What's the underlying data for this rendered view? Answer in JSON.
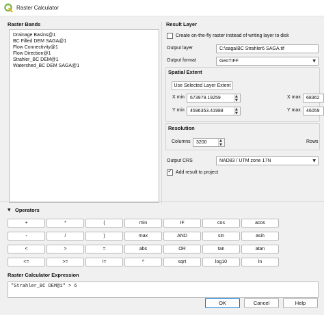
{
  "window": {
    "title": "Raster Calculator"
  },
  "raster_bands": {
    "heading": "Raster Bands",
    "items": [
      "Drainage Basins@1",
      "BC Filled DEM SAGA@1",
      "Flow Connectivity@1",
      "Flow Direction@1",
      "Strahler_BC DEM@1",
      "Watershed_BC DEM SAGA@1"
    ]
  },
  "result_layer": {
    "heading": "Result Layer",
    "create_on_the_fly_label": "Create on-the-fly raster instead of writing layer to disk",
    "create_on_the_fly_checked": false,
    "output_layer_label": "Output layer",
    "output_layer_value": "C:\\saga\\BC Strahler6 SAGA.tif",
    "output_format_label": "Output format",
    "output_format_value": "GeoTIFF",
    "spatial_extent": {
      "heading": "Spatial Extent",
      "use_selected_button": "Use Selected Layer Extent",
      "xmin_label": "X min",
      "xmin_value": "673979.19259",
      "xmax_label": "X max",
      "xmax_value": "68362",
      "ymin_label": "Y min",
      "ymin_value": "4596353.41988",
      "ymax_label": "Y max",
      "ymax_value": "46059"
    },
    "resolution": {
      "heading": "Resolution",
      "columns_label": "Columns",
      "columns_value": "3200",
      "rows_label": "Rows"
    },
    "output_crs_label": "Output CRS",
    "output_crs_value": "NAD83 / UTM zone 17N",
    "add_result_label": "Add result to project",
    "add_result_checked": true
  },
  "operators": {
    "heading": "Operators",
    "toggle_glyph": "▼",
    "rows": [
      [
        "+",
        "*",
        "(",
        "min",
        "IF",
        "cos",
        "acos"
      ],
      [
        "-",
        "/",
        ")",
        "max",
        "AND",
        "sin",
        "asin"
      ],
      [
        "<",
        ">",
        "=",
        "abs",
        "OR",
        "tan",
        "atan"
      ],
      [
        "<=",
        ">=",
        "!=",
        "^",
        "sqrt",
        "log10",
        "ln"
      ]
    ]
  },
  "expression": {
    "heading": "Raster Calculator Expression",
    "value": "\"Strahler_BC DEM@1\" > 6"
  },
  "buttons": {
    "ok": "OK",
    "cancel": "Cancel",
    "help": "Help"
  }
}
